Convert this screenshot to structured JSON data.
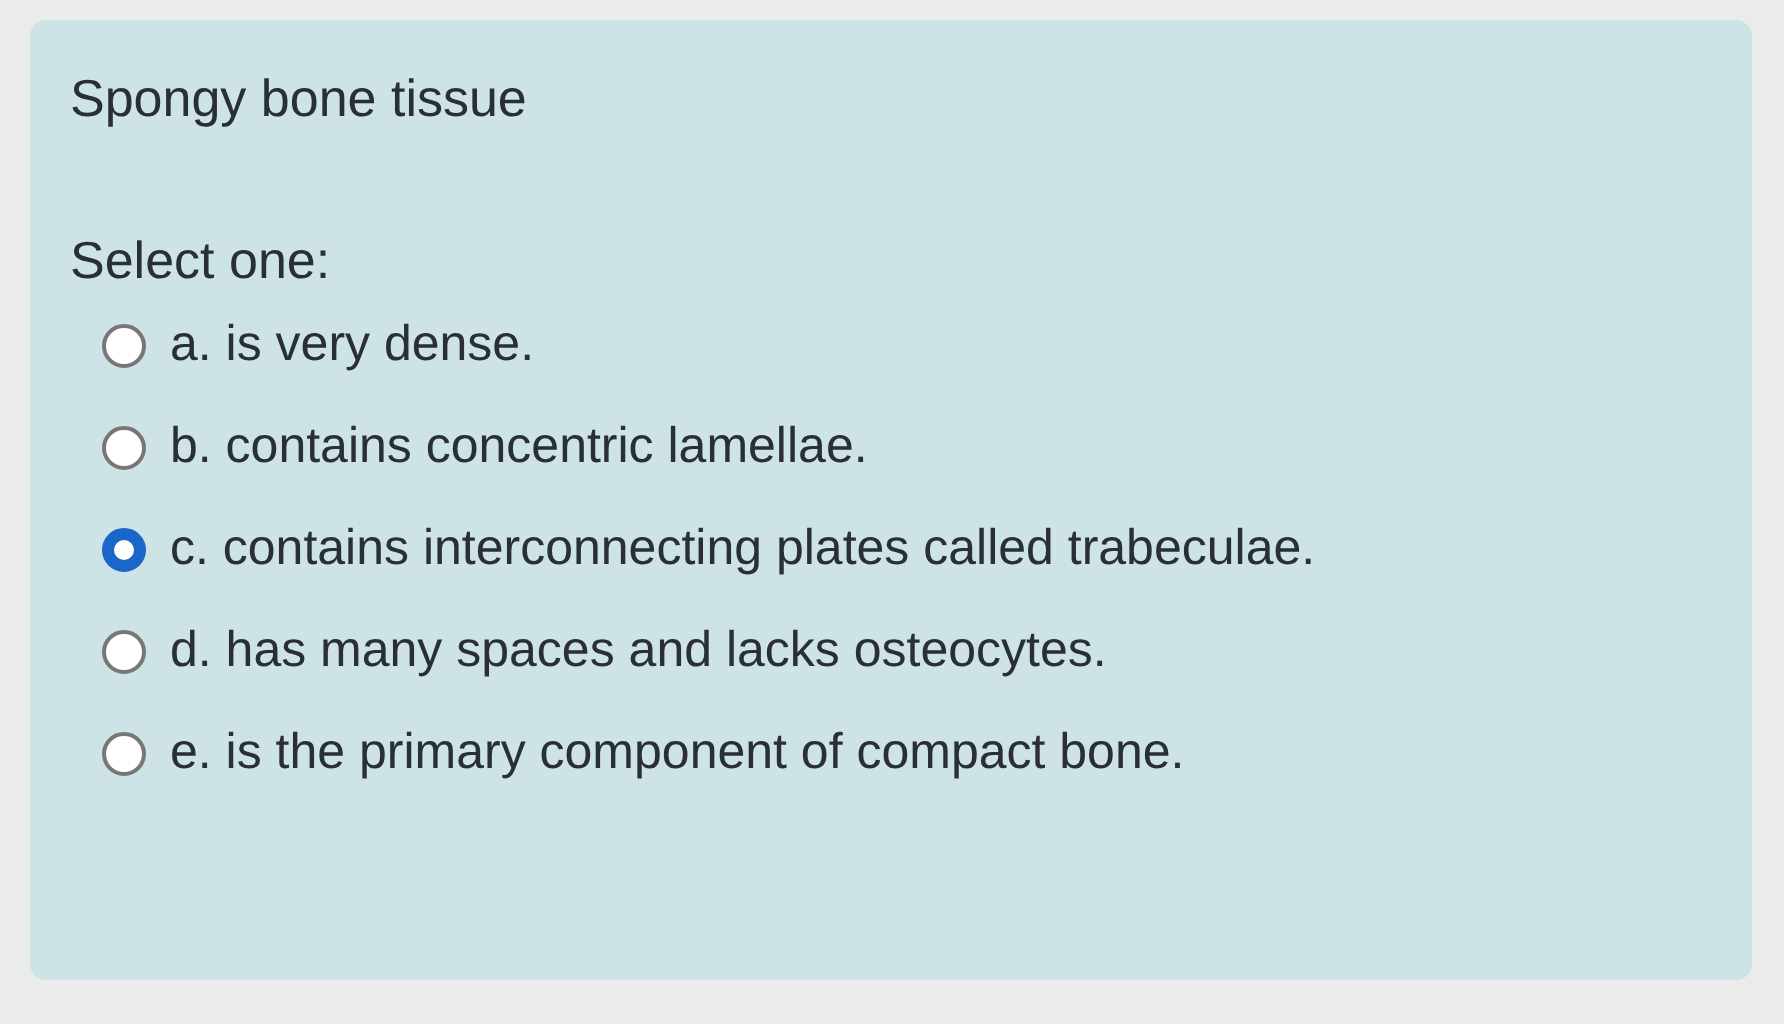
{
  "question": {
    "text": "Spongy bone tissue",
    "prompt": "Select one:",
    "options": [
      {
        "label": "a. is very dense.",
        "selected": false
      },
      {
        "label": "b. contains concentric lamellae.",
        "selected": false
      },
      {
        "label": "c. contains interconnecting plates called trabeculae.",
        "selected": true
      },
      {
        "label": "d. has many spaces and lacks osteocytes.",
        "selected": false
      },
      {
        "label": "e. is the primary component of compact bone.",
        "selected": false
      }
    ]
  }
}
